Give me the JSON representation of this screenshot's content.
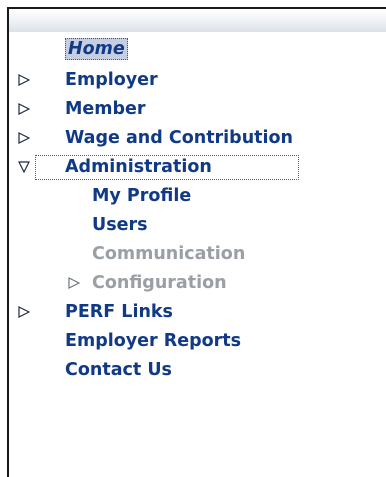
{
  "nav": {
    "items": [
      {
        "label": "Home",
        "level": 0,
        "expander": "none",
        "selected": true
      },
      {
        "label": "Employer",
        "level": 0,
        "expander": "collapsed"
      },
      {
        "label": "Member",
        "level": 0,
        "expander": "collapsed"
      },
      {
        "label": "Wage and Contribution",
        "level": 0,
        "expander": "collapsed"
      },
      {
        "label": "Administration",
        "level": 0,
        "expander": "expanded",
        "focused": true
      },
      {
        "label": "My Profile",
        "level": 1,
        "expander": "none"
      },
      {
        "label": "Users",
        "level": 1,
        "expander": "none"
      },
      {
        "label": "Communication",
        "level": 1,
        "expander": "none",
        "disabled": true
      },
      {
        "label": "Configuration",
        "level": 1,
        "expander": "collapsed",
        "disabled": true
      },
      {
        "label": "PERF Links",
        "level": 0,
        "expander": "collapsed"
      },
      {
        "label": "Employer Reports",
        "level": 0,
        "expander": "none"
      },
      {
        "label": "Contact Us",
        "level": 0,
        "expander": "none"
      }
    ]
  },
  "colors": {
    "link": "#103a86",
    "disabled": "#9a9fa6",
    "home_highlight": "#c6cee2"
  },
  "icons": {
    "collapsed": "triangle-right-icon",
    "expanded": "triangle-down-icon"
  }
}
